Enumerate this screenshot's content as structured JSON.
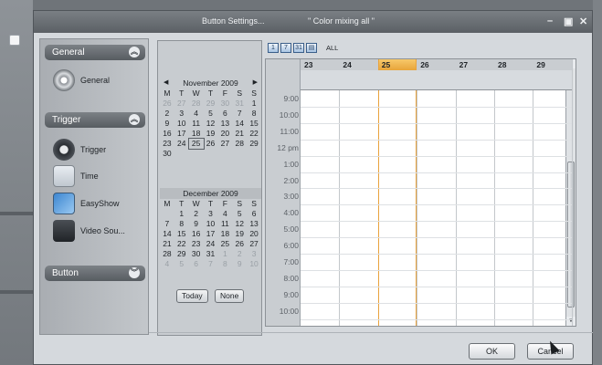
{
  "window": {
    "title": "Button Settings...",
    "subtitle": "\" Color mixing all \""
  },
  "left_panel": {
    "sections": [
      {
        "label": "General",
        "items": [
          {
            "label": "General",
            "icon": "gear-icon"
          }
        ]
      },
      {
        "label": "Trigger",
        "items": [
          {
            "label": "Trigger",
            "icon": "trigger-icon"
          },
          {
            "label": "Time",
            "icon": "calendar-time-icon"
          },
          {
            "label": "EasyShow",
            "icon": "easyshow-icon"
          },
          {
            "label": "Video Sou...",
            "icon": "video-camera-icon"
          }
        ]
      },
      {
        "label": "Button",
        "items": []
      }
    ]
  },
  "calendar": {
    "months": [
      {
        "title": "November 2009",
        "weekdays": [
          "M",
          "T",
          "W",
          "T",
          "F",
          "S",
          "S"
        ],
        "weeks": [
          [
            {
              "d": "26",
              "dim": true
            },
            {
              "d": "27",
              "dim": true
            },
            {
              "d": "28",
              "dim": true
            },
            {
              "d": "29",
              "dim": true
            },
            {
              "d": "30",
              "dim": true
            },
            {
              "d": "31",
              "dim": true
            },
            {
              "d": "1"
            }
          ],
          [
            {
              "d": "2"
            },
            {
              "d": "3"
            },
            {
              "d": "4"
            },
            {
              "d": "5"
            },
            {
              "d": "6"
            },
            {
              "d": "7"
            },
            {
              "d": "8"
            }
          ],
          [
            {
              "d": "9"
            },
            {
              "d": "10"
            },
            {
              "d": "11"
            },
            {
              "d": "12"
            },
            {
              "d": "13"
            },
            {
              "d": "14"
            },
            {
              "d": "15"
            }
          ],
          [
            {
              "d": "16"
            },
            {
              "d": "17"
            },
            {
              "d": "18"
            },
            {
              "d": "19"
            },
            {
              "d": "20"
            },
            {
              "d": "21"
            },
            {
              "d": "22"
            }
          ],
          [
            {
              "d": "23"
            },
            {
              "d": "24"
            },
            {
              "d": "25",
              "sel": true
            },
            {
              "d": "26"
            },
            {
              "d": "27"
            },
            {
              "d": "28"
            },
            {
              "d": "29"
            }
          ],
          [
            {
              "d": "30"
            }
          ]
        ]
      },
      {
        "title": "December 2009",
        "weekdays": [
          "M",
          "T",
          "W",
          "T",
          "F",
          "S",
          "S"
        ],
        "weeks": [
          [
            {
              "d": ""
            },
            {
              "d": "1"
            },
            {
              "d": "2"
            },
            {
              "d": "3"
            },
            {
              "d": "4"
            },
            {
              "d": "5"
            },
            {
              "d": "6"
            }
          ],
          [
            {
              "d": "7"
            },
            {
              "d": "8"
            },
            {
              "d": "9"
            },
            {
              "d": "10"
            },
            {
              "d": "11"
            },
            {
              "d": "12"
            },
            {
              "d": "13"
            }
          ],
          [
            {
              "d": "14"
            },
            {
              "d": "15"
            },
            {
              "d": "16"
            },
            {
              "d": "17"
            },
            {
              "d": "18"
            },
            {
              "d": "19"
            },
            {
              "d": "20"
            }
          ],
          [
            {
              "d": "21"
            },
            {
              "d": "22"
            },
            {
              "d": "23"
            },
            {
              "d": "24"
            },
            {
              "d": "25"
            },
            {
              "d": "26"
            },
            {
              "d": "27"
            }
          ],
          [
            {
              "d": "28"
            },
            {
              "d": "29"
            },
            {
              "d": "30"
            },
            {
              "d": "31"
            },
            {
              "d": "1",
              "dim": true
            },
            {
              "d": "2",
              "dim": true
            },
            {
              "d": "3",
              "dim": true
            }
          ],
          [
            {
              "d": "4",
              "dim": true
            },
            {
              "d": "5",
              "dim": true
            },
            {
              "d": "6",
              "dim": true
            },
            {
              "d": "7",
              "dim": true
            },
            {
              "d": "8",
              "dim": true
            },
            {
              "d": "9",
              "dim": true
            },
            {
              "d": "10",
              "dim": true
            }
          ]
        ]
      }
    ],
    "today_label": "Today",
    "none_label": "None"
  },
  "view_toolbar": {
    "buttons": [
      "1",
      "7",
      "31",
      "list"
    ],
    "all_label": "ALL"
  },
  "schedule": {
    "days": [
      "23",
      "24",
      "25",
      "26",
      "27",
      "28",
      "29"
    ],
    "today_index": 2,
    "times": [
      "9:00",
      "10:00",
      "11:00",
      "12 pm",
      "1:00",
      "2:00",
      "3:00",
      "4:00",
      "5:00",
      "6:00",
      "7:00",
      "8:00",
      "9:00",
      "10:00"
    ],
    "accent": "#e9a33d"
  },
  "dialog": {
    "ok_label": "OK",
    "cancel_label": "Cancel"
  }
}
